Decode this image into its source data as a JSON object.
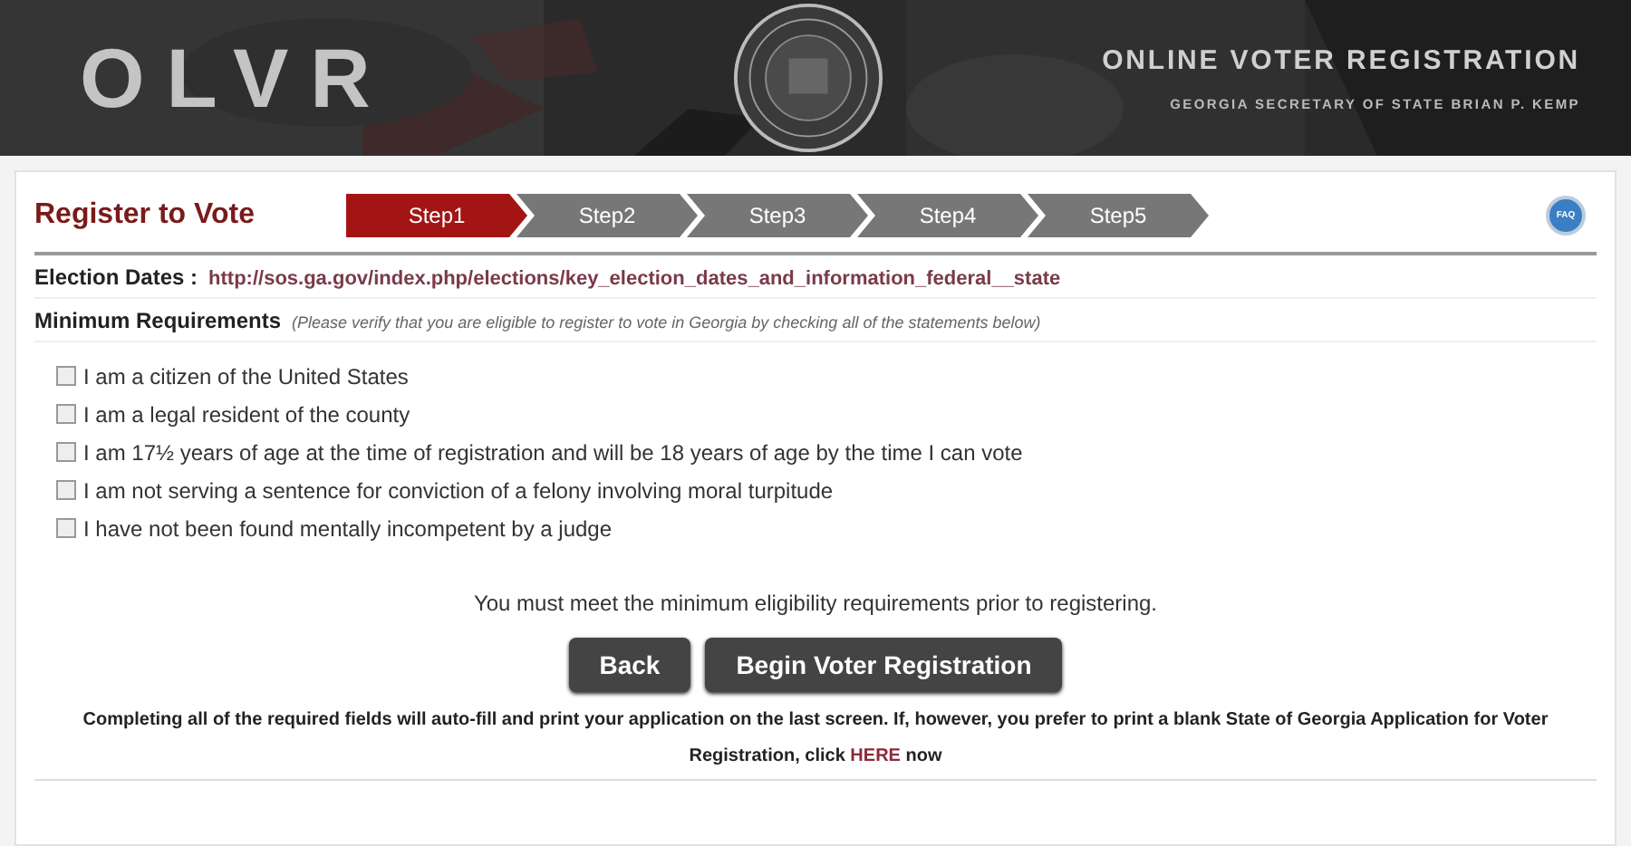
{
  "header": {
    "logo": "OLVR",
    "title": "ONLINE VOTER REGISTRATION",
    "subtitle": "GEORGIA SECRETARY OF STATE BRIAN P. KEMP"
  },
  "page_title": "Register to Vote",
  "steps": [
    {
      "label": "Step1",
      "selected": true
    },
    {
      "label": "Step2",
      "selected": false
    },
    {
      "label": "Step3",
      "selected": false
    },
    {
      "label": "Step4",
      "selected": false
    },
    {
      "label": "Step5",
      "selected": false
    }
  ],
  "faq": "FAQ",
  "election_dates": {
    "label": "Election Dates :",
    "link": "http://sos.ga.gov/index.php/elections/key_election_dates_and_information_federal__state"
  },
  "requirements": {
    "label": "Minimum Requirements",
    "note": "(Please verify that you are eligible to register to vote in Georgia by checking all of the statements below)"
  },
  "statements": [
    {
      "label": "I am a citizen of the United States",
      "checked": false
    },
    {
      "label": "I am a legal resident of the county",
      "checked": false
    },
    {
      "label": "I am 17½ years of age at the time of registration and will be 18 years of age by the time I can vote",
      "checked": false
    },
    {
      "label": "I am not serving a sentence for conviction of a felony involving moral turpitude",
      "checked": false
    },
    {
      "label": "I have not been found mentally incompetent by a judge",
      "checked": false
    }
  ],
  "notice": "You must meet the minimum eligibility requirements prior to registering.",
  "buttons": [
    "Back",
    "Begin Voter Registration"
  ],
  "footer": {
    "text": "Completing all of the required fields will auto-fill and print your application on the last screen. If, however, you prefer to print a blank State of Georgia Application for Voter Registration, click",
    "link": "HERE",
    "after": "now"
  }
}
